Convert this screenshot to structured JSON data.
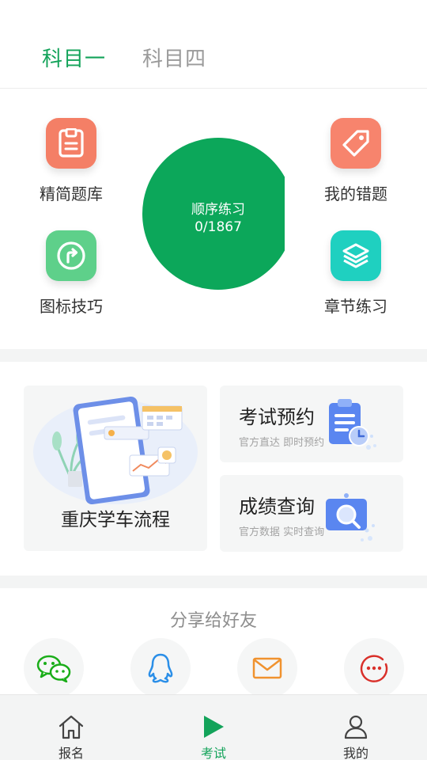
{
  "tabs": [
    {
      "label": "科目一",
      "active": true
    },
    {
      "label": "科目四",
      "active": false
    }
  ],
  "features": {
    "left_top": {
      "label": "精简题库",
      "icon": "notepad-icon",
      "color": "#f47f66"
    },
    "left_bottom": {
      "label": "图标技巧",
      "icon": "turn-arrow-icon",
      "color": "#5ed08a"
    },
    "right_top": {
      "label": "我的错题",
      "icon": "tag-icon",
      "color": "#f7846d"
    },
    "right_bottom": {
      "label": "章节练习",
      "icon": "layers-icon",
      "color": "#1fd0c0"
    }
  },
  "sequential": {
    "label": "顺序练习",
    "progress_text": "0/1867",
    "done": 0,
    "total": 1867
  },
  "cards": {
    "process": {
      "title": "重庆学车流程"
    },
    "exam_booking": {
      "title": "考试预约",
      "subtitle": "官方直达 即时预约"
    },
    "score_query": {
      "title": "成绩查询",
      "subtitle": "官方数据 实时查询"
    }
  },
  "share": {
    "title": "分享给好友",
    "targets": [
      "wechat-icon",
      "qq-icon",
      "mail-icon",
      "more-icon"
    ]
  },
  "bottom_nav": [
    {
      "label": "报名",
      "icon": "home-icon",
      "active": false
    },
    {
      "label": "考试",
      "icon": "play-icon",
      "active": true
    },
    {
      "label": "我的",
      "icon": "user-icon",
      "active": false
    }
  ],
  "colors": {
    "brand_green": "#13a35a",
    "circle_green": "#0ca75a",
    "inactive_text": "#9a9a9a"
  }
}
